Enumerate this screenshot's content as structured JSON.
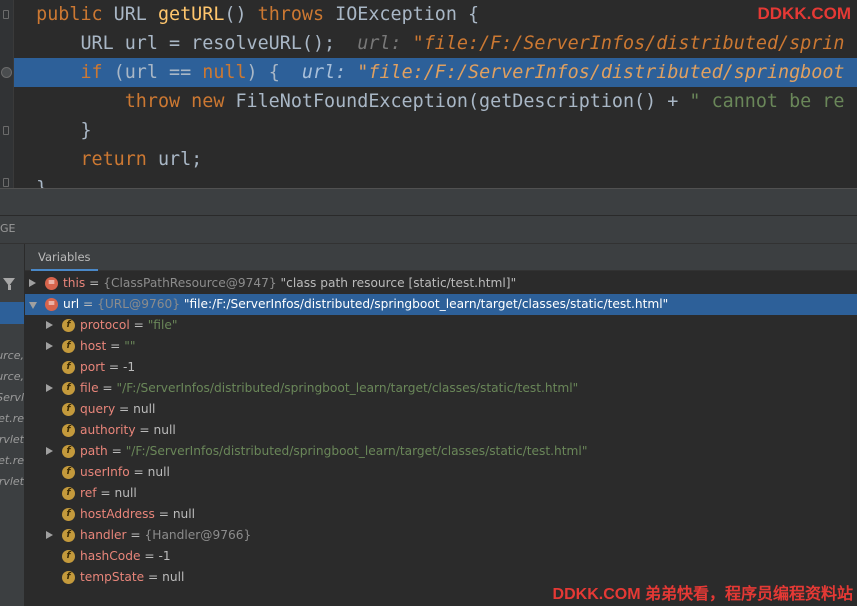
{
  "watermark_top": "DDKK.COM",
  "watermark_bottom": "DDKK.COM 弟弟快看，程序员编程资料站",
  "code": {
    "line1": {
      "kw1": "public",
      "t1": " URL ",
      "fn": "getURL",
      "t2": "() ",
      "kw2": "throws",
      "t3": " IOException {"
    },
    "line2": {
      "t1": "    URL url = resolveURL();",
      "hint_label": "url: ",
      "hint_value": "\"file:/F:/ServerInfos/distributed/sprin"
    },
    "line3": {
      "kw1": "    if",
      "t1": " (url == ",
      "kw2": "null",
      "t2": ") {",
      "hint_label": "url: ",
      "hint_value": "\"file:/F:/ServerInfos/distributed/springboot"
    },
    "line4": {
      "kw1": "        throw",
      "t0": " ",
      "kw2": "new",
      "t1": " FileNotFoundException(getDescription() + ",
      "str": "\" cannot be re"
    },
    "line5": {
      "t1": "    }"
    },
    "line6": {
      "kw1": "    return",
      "t1": " url;"
    },
    "line7": {
      "t1": "}"
    }
  },
  "panel": {
    "strip_label": "GE",
    "tab_variables": "Variables"
  },
  "frames": [
    "urce,",
    "urce,",
    "Servl",
    "et.re",
    "rvlet",
    "et.re",
    "rvlet"
  ],
  "variables": [
    {
      "expand": "right",
      "icon": "=",
      "name": "this",
      "eq": " = ",
      "obj": "{ClassPathResource@9747}",
      "val": " \"class path resource [static/test.html]\"",
      "selected": false
    },
    {
      "expand": "down",
      "icon": "=",
      "name": "url",
      "eq": " = ",
      "obj": "{URL@9760}",
      "val": " \"file:/F:/ServerInfos/distributed/springboot_learn/target/classes/static/test.html\"",
      "selected": true
    },
    {
      "expand": "right",
      "icon": "f",
      "name": "protocol",
      "eq": " = ",
      "str": "\"file\""
    },
    {
      "expand": "right",
      "icon": "f",
      "name": "host",
      "eq": " = ",
      "str": "\"\""
    },
    {
      "expand": "",
      "icon": "f",
      "name": "port",
      "eq": " = ",
      "plain": "-1"
    },
    {
      "expand": "right",
      "icon": "f",
      "name": "file",
      "eq": " = ",
      "str": "\"/F:/ServerInfos/distributed/springboot_learn/target/classes/static/test.html\""
    },
    {
      "expand": "",
      "icon": "f",
      "name": "query",
      "eq": " = ",
      "plain": "null"
    },
    {
      "expand": "",
      "icon": "f",
      "name": "authority",
      "eq": " = ",
      "plain": "null"
    },
    {
      "expand": "right",
      "icon": "f",
      "name": "path",
      "eq": " = ",
      "str": "\"/F:/ServerInfos/distributed/springboot_learn/target/classes/static/test.html\""
    },
    {
      "expand": "",
      "icon": "f",
      "name": "userInfo",
      "eq": " = ",
      "plain": "null"
    },
    {
      "expand": "",
      "icon": "f",
      "name": "ref",
      "eq": " = ",
      "plain": "null"
    },
    {
      "expand": "",
      "icon": "f",
      "name": "hostAddress",
      "eq": " = ",
      "plain": "null"
    },
    {
      "expand": "right",
      "icon": "f",
      "name": "handler",
      "eq": " = ",
      "obj": "{Handler@9766}"
    },
    {
      "expand": "",
      "icon": "f",
      "name": "hashCode",
      "eq": " = ",
      "plain": "-1"
    },
    {
      "expand": "",
      "icon": "f",
      "name": "tempState",
      "eq": " = ",
      "plain": "null"
    }
  ]
}
